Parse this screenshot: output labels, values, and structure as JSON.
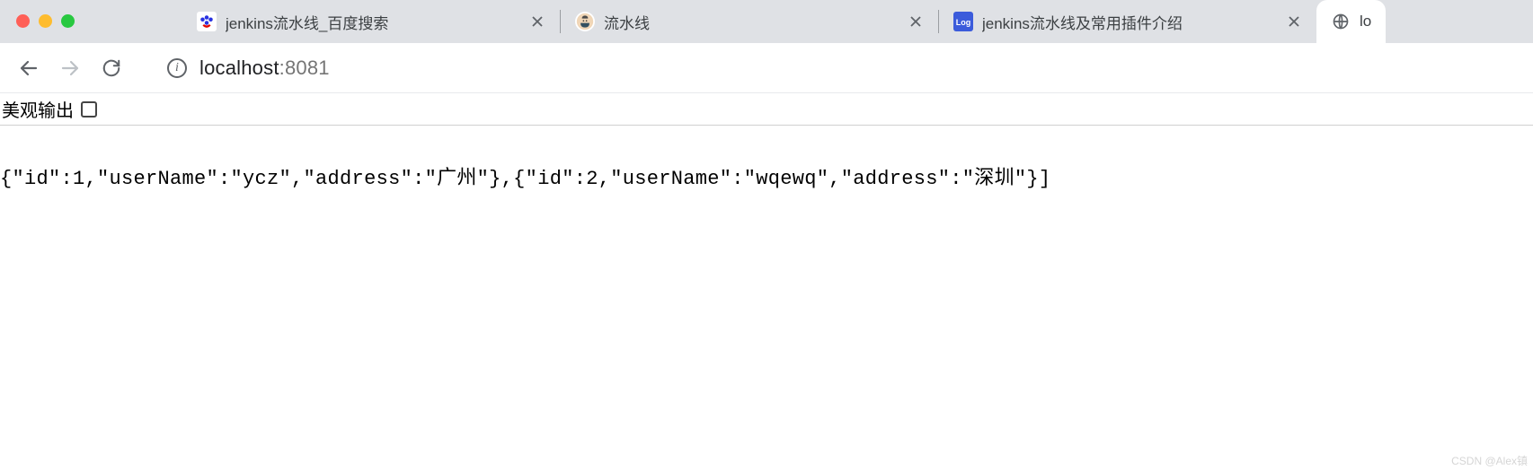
{
  "tabs": [
    {
      "title": "jenkins流水线_百度搜索",
      "favicon": "baidu"
    },
    {
      "title": "流水线",
      "favicon": "jenkins"
    },
    {
      "title": "jenkins流水线及常用插件介绍",
      "favicon": "csdn"
    },
    {
      "title": "lo",
      "favicon": "globe"
    }
  ],
  "address": {
    "host": "localhost",
    "port": ":8081"
  },
  "prettify": {
    "label": "美观输出",
    "checked": false
  },
  "body_text": "{\"id\":1,\"userName\":\"ycz\",\"address\":\"广州\"},{\"id\":2,\"userName\":\"wqewq\",\"address\":\"深圳\"}]",
  "watermark": "CSDN @Alex镇"
}
